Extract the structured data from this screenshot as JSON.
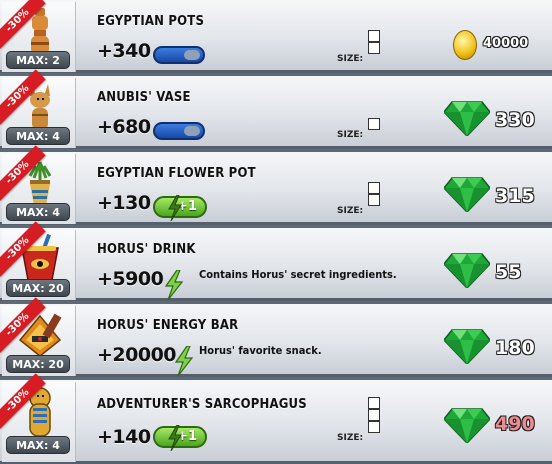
{
  "items": [
    {
      "name": "EGYPTIAN POTS",
      "discount": "-30%",
      "max": "MAX: 2",
      "stat": "+340",
      "indicator": "blue-bar",
      "size_label": "SIZE:",
      "size_cells": 2,
      "currency": "coin",
      "price": "40000",
      "price_color": "#ffffff",
      "icon": "egyptian-pots-icon"
    },
    {
      "name": "ANUBIS' VASE",
      "discount": "-30%",
      "max": "MAX: 4",
      "stat": "+680",
      "indicator": "blue-bar",
      "size_label": "SIZE:",
      "size_cells": 1,
      "currency": "gem",
      "price": "330",
      "price_color": "#ffffff",
      "icon": "anubis-vase-icon"
    },
    {
      "name": "EGYPTIAN FLOWER POT",
      "discount": "-30%",
      "max": "MAX: 4",
      "stat": "+130",
      "indicator": "energy",
      "energy_label": "+1",
      "size_label": "SIZE:",
      "size_cells": 2,
      "currency": "gem",
      "price": "315",
      "price_color": "#ffffff",
      "icon": "flower-pot-icon"
    },
    {
      "name": "HORUS' DRINK",
      "discount": "-30%",
      "max": "MAX: 20",
      "stat": "+5900",
      "indicator": "bolt",
      "description": "Contains Horus' secret ingredients.",
      "currency": "gem",
      "price": "55",
      "price_color": "#ffffff",
      "icon": "horus-drink-icon"
    },
    {
      "name": "HORUS' ENERGY BAR",
      "discount": "-30%",
      "max": "MAX: 20",
      "stat": "+20000",
      "indicator": "bolt",
      "description": "Horus' favorite snack.",
      "currency": "gem",
      "price": "180",
      "price_color": "#ffffff",
      "icon": "horus-energy-bar-icon"
    },
    {
      "name": "ADVENTURER'S SARCOPHAGUS",
      "discount": "-30%",
      "max": "MAX: 4",
      "stat": "+140",
      "indicator": "energy",
      "energy_label": "+1",
      "size_label": "SIZE:",
      "size_cells": 3,
      "currency": "gem",
      "price": "490",
      "price_color": "#f08a92",
      "icon": "sarcophagus-icon"
    }
  ]
}
